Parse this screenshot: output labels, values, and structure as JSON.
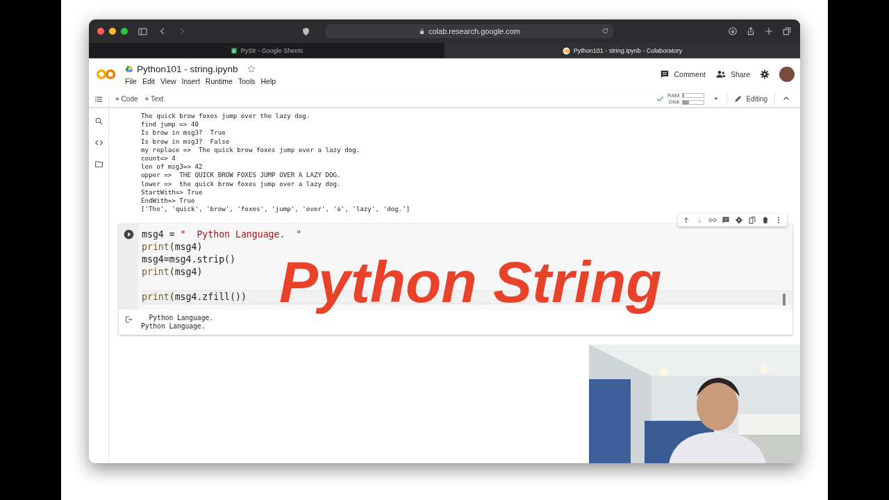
{
  "browser": {
    "address": "colab.research.google.com"
  },
  "tabs": [
    {
      "label": "PyStr - Google Sheets",
      "selected": false,
      "kind": "sheets"
    },
    {
      "label": "Python101 - string.ipynb - Colaboratory",
      "selected": true,
      "kind": "colab"
    }
  ],
  "notebook": {
    "title": "Python101 - string.ipynb",
    "starred": false,
    "menu": [
      "File",
      "Edit",
      "View",
      "Insert",
      "Runtime",
      "Tools",
      "Help"
    ],
    "actions": [
      {
        "label": "Comment",
        "kind": "comment"
      },
      {
        "label": "Share",
        "kind": "share"
      }
    ]
  },
  "toolbar": {
    "add_buttons": [
      "+ Code",
      "+ Text"
    ],
    "connected": true,
    "meters": [
      {
        "label": "RAM",
        "level": 0.06
      },
      {
        "label": "Disk",
        "level": 0.3
      }
    ],
    "mode": "Editing"
  },
  "output_above": [
    "The quick brow foxes jump over the lazy dog.",
    "find jump => 40",
    "Is brow in msg3?  True",
    "Is brow in msg3?  False",
    "my replace =>  The quick brow foxes jump over a lazy dog.",
    "count=> 4",
    "len of msg3=> 42",
    "upper =>  THE QUICK BROW FOXES JUMP OVER A LAZY DOG.",
    "lower =>  the quick brow foxes jump over a lazy dog.",
    "StartWith=> True",
    "EndWith=> True",
    "['The', 'quick', 'brow', 'foxes', 'jump', 'over', 'a', 'lazy', 'dog.']"
  ],
  "cell": {
    "lines": [
      {
        "kind": "code",
        "segments": [
          {
            "kind": "plain",
            "text": "msg4 = "
          },
          {
            "kind": "string",
            "text": "\"  Python Language.  \""
          }
        ]
      },
      {
        "kind": "code",
        "segments": [
          {
            "kind": "builtin",
            "text": "print"
          },
          {
            "kind": "plain",
            "text": "(msg4)"
          }
        ]
      },
      {
        "kind": "code",
        "segments": [
          {
            "kind": "plain",
            "text": "msg4=msg4.strip()"
          }
        ]
      },
      {
        "kind": "code",
        "segments": [
          {
            "kind": "builtin",
            "text": "print"
          },
          {
            "kind": "plain",
            "text": "(msg4)"
          }
        ]
      },
      {
        "kind": "blank"
      },
      {
        "kind": "code",
        "segments": [
          {
            "kind": "builtin",
            "text": "print"
          },
          {
            "kind": "plain",
            "text": "(msg4.zfill()"
          },
          {
            "kind": "plain",
            "text": ")"
          }
        ]
      }
    ],
    "output": [
      "  Python Language.",
      "Python Language."
    ]
  },
  "overlay_title": "Python String"
}
